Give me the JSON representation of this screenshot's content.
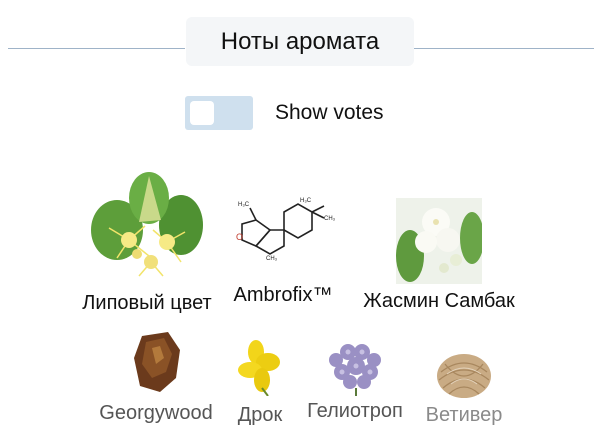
{
  "header": {
    "title": "Ноты аромата"
  },
  "votes_toggle": {
    "label": "Show votes",
    "on": false
  },
  "notes_row1": [
    {
      "name": "Липовый цвет",
      "icon": "linden-blossom-icon"
    },
    {
      "name": "Ambrofix™",
      "icon": "ambrofix-molecule-icon"
    },
    {
      "name": "Жасмин Самбак",
      "icon": "jasmine-sambac-icon"
    }
  ],
  "notes_row2": [
    {
      "name": "Georgywood",
      "icon": "georgywood-resin-icon"
    },
    {
      "name": "Дрок",
      "icon": "gorse-flower-icon"
    },
    {
      "name": "Гелиотроп",
      "icon": "heliotrope-flower-icon"
    },
    {
      "name": "Ветивер",
      "icon": "vetiver-root-icon"
    }
  ],
  "colors": {
    "rule": "#9fb3c8",
    "toggle_bg": "#cfe0ee",
    "title_bg": "#f4f6f8"
  }
}
